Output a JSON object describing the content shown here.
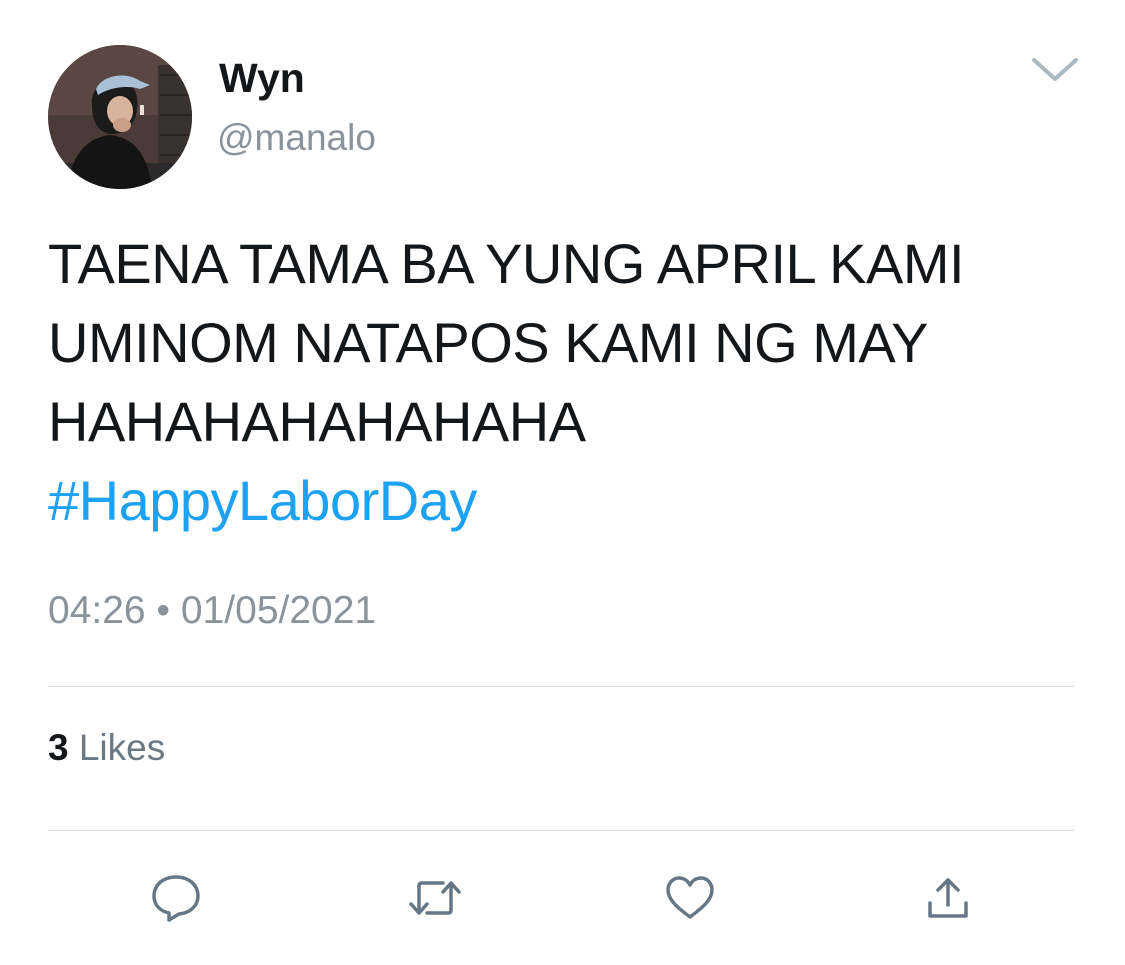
{
  "tweet": {
    "author": {
      "display_name": "Wyn",
      "handle": "@manalo"
    },
    "text_lines": [
      "TAENA TAMA BA YUNG APRIL KAMI",
      "UMINOM NATAPOS KAMI NG MAY",
      "HAHAHAHAHAHAHA"
    ],
    "hashtag": "#HappyLaborDay",
    "timestamp": "04:26 • 01/05/2021",
    "likes": {
      "count": "3",
      "label": "Likes"
    }
  },
  "icons": {
    "menu": "chevron-down-icon",
    "reply": "reply-icon",
    "retweet": "retweet-icon",
    "like": "heart-icon",
    "share": "share-icon"
  },
  "colors": {
    "text": "#14171a",
    "secondary": "#8a939c",
    "link": "#1da1f2",
    "divider": "#d9dee2",
    "icon": "#657786"
  }
}
